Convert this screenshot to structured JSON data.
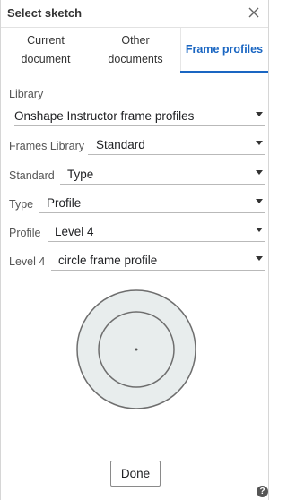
{
  "dialog": {
    "title": "Select sketch"
  },
  "tabs": [
    {
      "line1": "Current",
      "line2": "document",
      "active": false
    },
    {
      "line1": "Other",
      "line2": "documents",
      "active": false
    },
    {
      "line1": "Frame profiles",
      "line2": "",
      "active": true
    }
  ],
  "fields": {
    "library": {
      "label": "Library",
      "value": "Onshape Instructor frame profiles"
    },
    "frames_library": {
      "label": "Frames Library",
      "value": "Standard"
    },
    "standard": {
      "label": "Standard",
      "value": "Type"
    },
    "type": {
      "label": "Type",
      "value": "Profile"
    },
    "profile": {
      "label": "Profile",
      "value": "Level 4"
    },
    "level4": {
      "label": "Level 4",
      "value": "circle frame profile"
    }
  },
  "footer": {
    "done_label": "Done",
    "help_glyph": "?"
  },
  "icons": {
    "close": "close-icon",
    "help": "help-icon",
    "caret": "chevron-down-icon"
  },
  "colors": {
    "accent": "#1a66c2",
    "preview_fill": "#e8eded",
    "preview_stroke": "#6e6e6e"
  }
}
